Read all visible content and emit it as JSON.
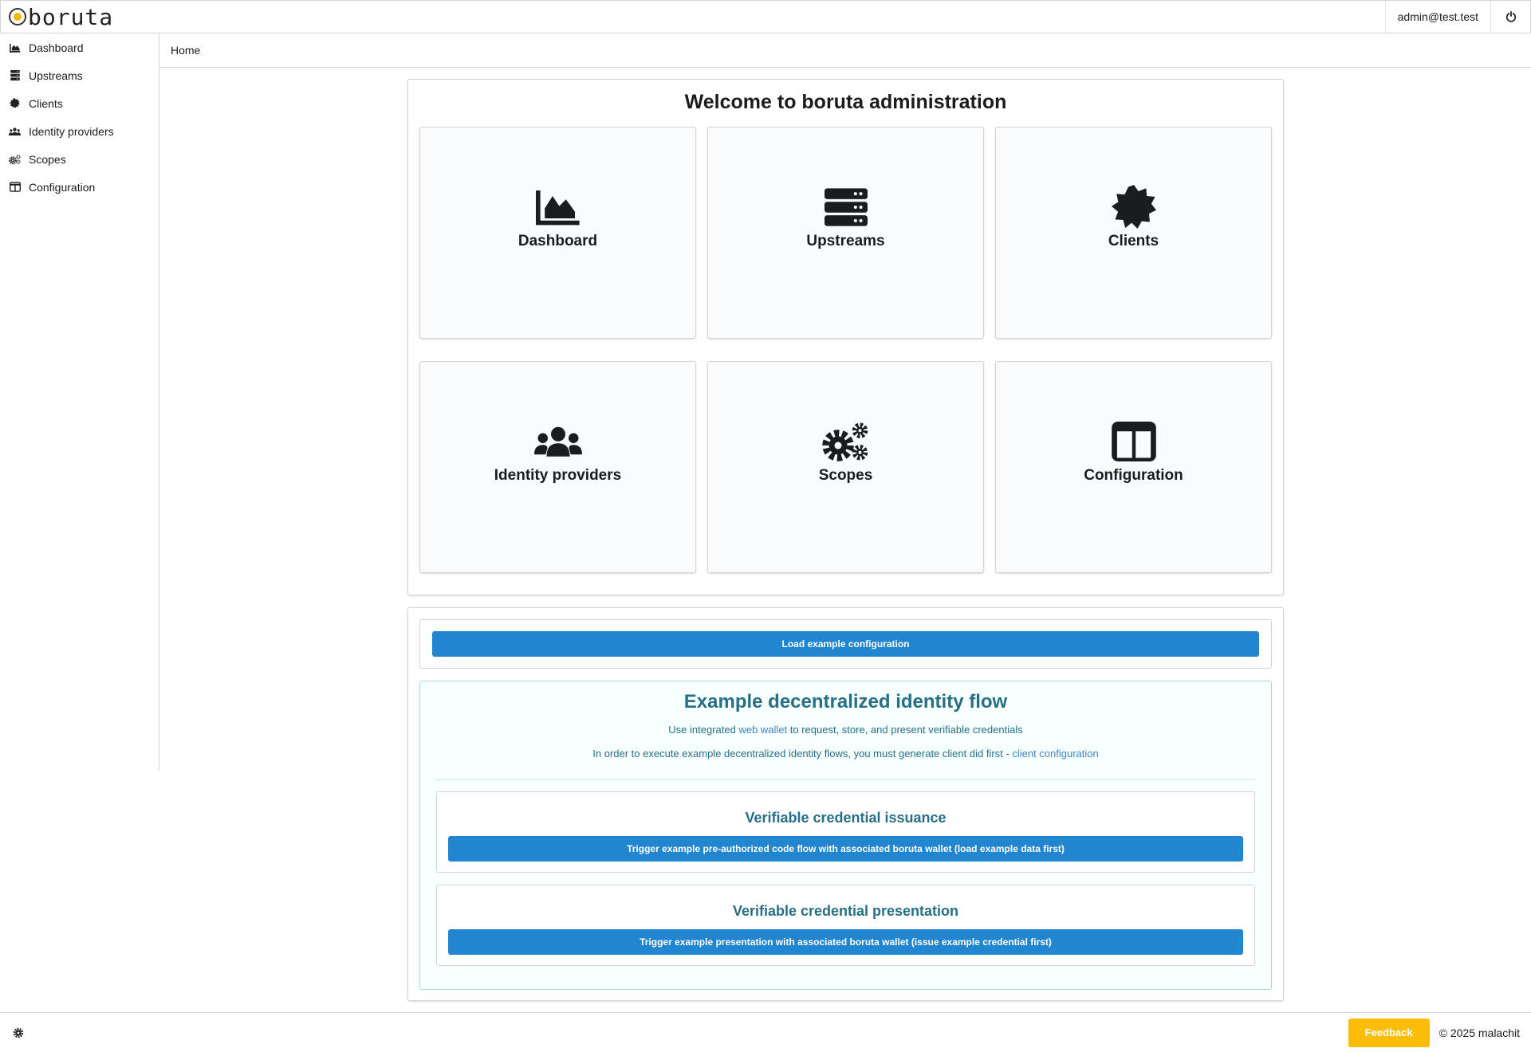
{
  "app": {
    "logo_text": "boruta"
  },
  "header": {
    "user_email": "admin@test.test",
    "power_icon": "power-icon"
  },
  "sidebar": {
    "items": [
      {
        "label": "Dashboard",
        "icon": "area-chart-icon"
      },
      {
        "label": "Upstreams",
        "icon": "server-icon"
      },
      {
        "label": "Clients",
        "icon": "certificate-icon"
      },
      {
        "label": "Identity providers",
        "icon": "users-icon"
      },
      {
        "label": "Scopes",
        "icon": "cogs-icon"
      },
      {
        "label": "Configuration",
        "icon": "columns-icon"
      }
    ]
  },
  "breadcrumb": {
    "home": "Home"
  },
  "welcome": {
    "title": "Welcome to boruta administration",
    "tiles": [
      {
        "label": "Dashboard",
        "icon": "area-chart-icon"
      },
      {
        "label": "Upstreams",
        "icon": "server-icon"
      },
      {
        "label": "Clients",
        "icon": "certificate-icon"
      },
      {
        "label": "Identity providers",
        "icon": "users-icon"
      },
      {
        "label": "Scopes",
        "icon": "cogs-icon"
      },
      {
        "label": "Configuration",
        "icon": "columns-icon"
      }
    ]
  },
  "examples": {
    "load_button": "Load example configuration",
    "did_title": "Example decentralized identity flow",
    "line1_before": "Use integrated ",
    "line1_link": "web wallet",
    "line1_after": " to request, store, and present verifiable credentials",
    "line2_before": "In order to execute example decentralized identity flows, you must generate client did first - ",
    "line2_link": "client configuration",
    "issuance_title": "Verifiable credential issuance",
    "issuance_button": "Trigger example pre-authorized code flow with associated boruta wallet (load example data first)",
    "presentation_title": "Verifiable credential presentation",
    "presentation_button": "Trigger example presentation with associated boruta wallet (issue example credential first)"
  },
  "footer": {
    "feedback": "Feedback",
    "copyright": "© 2025 malachit",
    "feedback_color": "#fbbd08"
  },
  "colors": {
    "primary": "#2185d0",
    "info_text": "#276f86",
    "info_bg": "#f8ffff"
  }
}
